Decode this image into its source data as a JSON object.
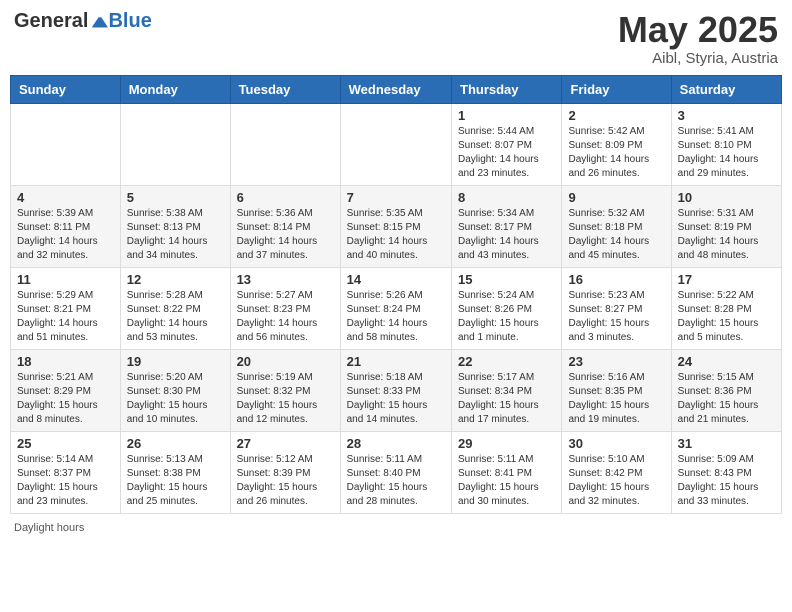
{
  "header": {
    "logo_general": "General",
    "logo_blue": "Blue",
    "month_title": "May 2025",
    "location": "Aibl, Styria, Austria"
  },
  "calendar": {
    "days_of_week": [
      "Sunday",
      "Monday",
      "Tuesday",
      "Wednesday",
      "Thursday",
      "Friday",
      "Saturday"
    ],
    "weeks": [
      [
        {
          "num": "",
          "info": ""
        },
        {
          "num": "",
          "info": ""
        },
        {
          "num": "",
          "info": ""
        },
        {
          "num": "",
          "info": ""
        },
        {
          "num": "1",
          "info": "Sunrise: 5:44 AM\nSunset: 8:07 PM\nDaylight: 14 hours and 23 minutes."
        },
        {
          "num": "2",
          "info": "Sunrise: 5:42 AM\nSunset: 8:09 PM\nDaylight: 14 hours and 26 minutes."
        },
        {
          "num": "3",
          "info": "Sunrise: 5:41 AM\nSunset: 8:10 PM\nDaylight: 14 hours and 29 minutes."
        }
      ],
      [
        {
          "num": "4",
          "info": "Sunrise: 5:39 AM\nSunset: 8:11 PM\nDaylight: 14 hours and 32 minutes."
        },
        {
          "num": "5",
          "info": "Sunrise: 5:38 AM\nSunset: 8:13 PM\nDaylight: 14 hours and 34 minutes."
        },
        {
          "num": "6",
          "info": "Sunrise: 5:36 AM\nSunset: 8:14 PM\nDaylight: 14 hours and 37 minutes."
        },
        {
          "num": "7",
          "info": "Sunrise: 5:35 AM\nSunset: 8:15 PM\nDaylight: 14 hours and 40 minutes."
        },
        {
          "num": "8",
          "info": "Sunrise: 5:34 AM\nSunset: 8:17 PM\nDaylight: 14 hours and 43 minutes."
        },
        {
          "num": "9",
          "info": "Sunrise: 5:32 AM\nSunset: 8:18 PM\nDaylight: 14 hours and 45 minutes."
        },
        {
          "num": "10",
          "info": "Sunrise: 5:31 AM\nSunset: 8:19 PM\nDaylight: 14 hours and 48 minutes."
        }
      ],
      [
        {
          "num": "11",
          "info": "Sunrise: 5:29 AM\nSunset: 8:21 PM\nDaylight: 14 hours and 51 minutes."
        },
        {
          "num": "12",
          "info": "Sunrise: 5:28 AM\nSunset: 8:22 PM\nDaylight: 14 hours and 53 minutes."
        },
        {
          "num": "13",
          "info": "Sunrise: 5:27 AM\nSunset: 8:23 PM\nDaylight: 14 hours and 56 minutes."
        },
        {
          "num": "14",
          "info": "Sunrise: 5:26 AM\nSunset: 8:24 PM\nDaylight: 14 hours and 58 minutes."
        },
        {
          "num": "15",
          "info": "Sunrise: 5:24 AM\nSunset: 8:26 PM\nDaylight: 15 hours and 1 minute."
        },
        {
          "num": "16",
          "info": "Sunrise: 5:23 AM\nSunset: 8:27 PM\nDaylight: 15 hours and 3 minutes."
        },
        {
          "num": "17",
          "info": "Sunrise: 5:22 AM\nSunset: 8:28 PM\nDaylight: 15 hours and 5 minutes."
        }
      ],
      [
        {
          "num": "18",
          "info": "Sunrise: 5:21 AM\nSunset: 8:29 PM\nDaylight: 15 hours and 8 minutes."
        },
        {
          "num": "19",
          "info": "Sunrise: 5:20 AM\nSunset: 8:30 PM\nDaylight: 15 hours and 10 minutes."
        },
        {
          "num": "20",
          "info": "Sunrise: 5:19 AM\nSunset: 8:32 PM\nDaylight: 15 hours and 12 minutes."
        },
        {
          "num": "21",
          "info": "Sunrise: 5:18 AM\nSunset: 8:33 PM\nDaylight: 15 hours and 14 minutes."
        },
        {
          "num": "22",
          "info": "Sunrise: 5:17 AM\nSunset: 8:34 PM\nDaylight: 15 hours and 17 minutes."
        },
        {
          "num": "23",
          "info": "Sunrise: 5:16 AM\nSunset: 8:35 PM\nDaylight: 15 hours and 19 minutes."
        },
        {
          "num": "24",
          "info": "Sunrise: 5:15 AM\nSunset: 8:36 PM\nDaylight: 15 hours and 21 minutes."
        }
      ],
      [
        {
          "num": "25",
          "info": "Sunrise: 5:14 AM\nSunset: 8:37 PM\nDaylight: 15 hours and 23 minutes."
        },
        {
          "num": "26",
          "info": "Sunrise: 5:13 AM\nSunset: 8:38 PM\nDaylight: 15 hours and 25 minutes."
        },
        {
          "num": "27",
          "info": "Sunrise: 5:12 AM\nSunset: 8:39 PM\nDaylight: 15 hours and 26 minutes."
        },
        {
          "num": "28",
          "info": "Sunrise: 5:11 AM\nSunset: 8:40 PM\nDaylight: 15 hours and 28 minutes."
        },
        {
          "num": "29",
          "info": "Sunrise: 5:11 AM\nSunset: 8:41 PM\nDaylight: 15 hours and 30 minutes."
        },
        {
          "num": "30",
          "info": "Sunrise: 5:10 AM\nSunset: 8:42 PM\nDaylight: 15 hours and 32 minutes."
        },
        {
          "num": "31",
          "info": "Sunrise: 5:09 AM\nSunset: 8:43 PM\nDaylight: 15 hours and 33 minutes."
        }
      ]
    ]
  },
  "footer": {
    "daylight_hours": "Daylight hours"
  }
}
